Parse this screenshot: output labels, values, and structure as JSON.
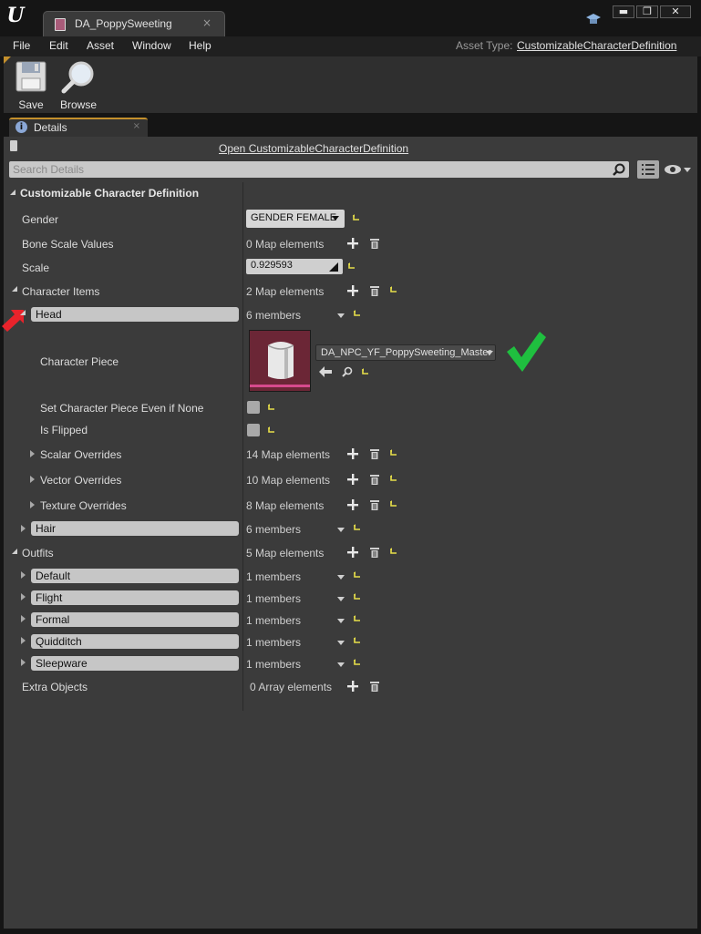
{
  "window": {
    "tab_title": "DA_PoppySweeting",
    "tab_close": "×",
    "minimize": "▬",
    "maximize": "❐",
    "close": "✕"
  },
  "menu": {
    "items": [
      "File",
      "Edit",
      "Asset",
      "Window",
      "Help"
    ],
    "asset_type_label": "Asset Type:",
    "asset_type_value": "CustomizableCharacterDefinition"
  },
  "toolbar": {
    "save_label": "Save",
    "browse_label": "Browse"
  },
  "details": {
    "tab_label": "Details",
    "tab_close": "×",
    "open_link": "Open CustomizableCharacterDefinition",
    "search_placeholder": "Search Details"
  },
  "properties": {
    "category": "Customizable Character Definition",
    "gender": {
      "label": "Gender",
      "value": "GENDER FEMALE"
    },
    "bone_scale": {
      "label": "Bone Scale Values",
      "value": "0 Map elements"
    },
    "scale": {
      "label": "Scale",
      "value": "0.929593"
    },
    "character_items": {
      "label": "Character Items",
      "value": "2 Map elements"
    },
    "head": {
      "key": "Head",
      "value": "6 members"
    },
    "character_piece": {
      "label": "Character Piece",
      "asset": "DA_NPC_YF_PoppySweeting_Master"
    },
    "set_piece_if_none": {
      "label": "Set Character Piece Even if None"
    },
    "is_flipped": {
      "label": "Is Flipped"
    },
    "scalar_overrides": {
      "label": "Scalar Overrides",
      "value": "14 Map elements"
    },
    "vector_overrides": {
      "label": "Vector Overrides",
      "value": "10 Map elements"
    },
    "texture_overrides": {
      "label": "Texture Overrides",
      "value": "8 Map elements"
    },
    "hair": {
      "key": "Hair",
      "value": "6 members"
    },
    "outfits": {
      "label": "Outfits",
      "value": "5 Map elements"
    },
    "outfit_entries": [
      {
        "key": "Default",
        "value": "1 members"
      },
      {
        "key": "Flight",
        "value": "1 members"
      },
      {
        "key": "Formal",
        "value": "1 members"
      },
      {
        "key": "Quidditch",
        "value": "1 members"
      },
      {
        "key": "Sleepware",
        "value": "1 members"
      }
    ],
    "extra_objects": {
      "label": "Extra Objects",
      "value": "0 Array elements"
    }
  },
  "colors": {
    "accent": "#c4902c",
    "reset_yellow": "#e8e04a",
    "annotation_red": "#e8232b",
    "annotation_green": "#1fbf3f",
    "asset_thumb": "#6b2636"
  }
}
